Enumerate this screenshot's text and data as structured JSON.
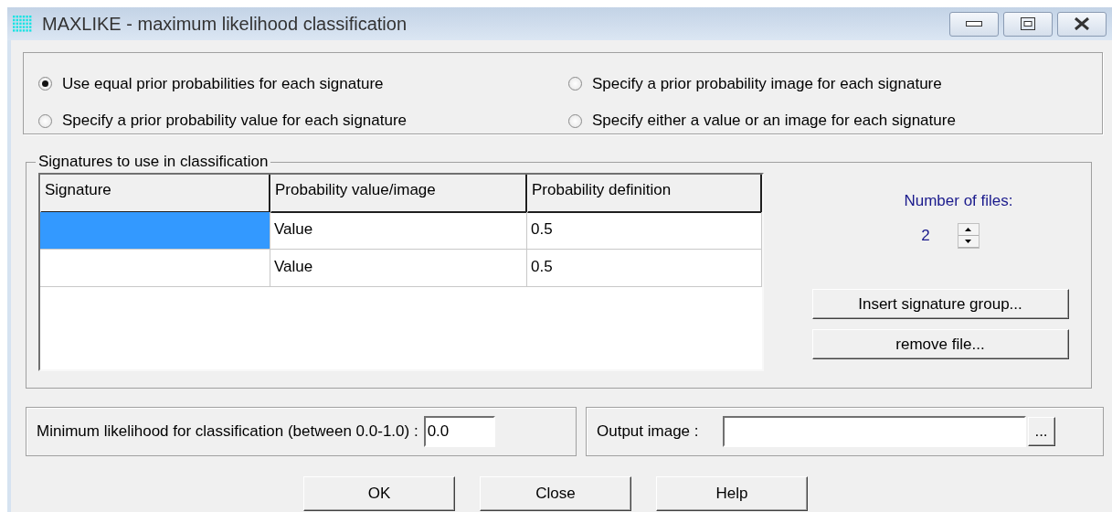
{
  "window": {
    "title": "MAXLIKE - maximum likelihood classification"
  },
  "prior_options": [
    {
      "label": "Use equal prior probabilities for each signature",
      "selected": true
    },
    {
      "label": "Specify a prior probability image for each signature",
      "selected": false
    },
    {
      "label": "Specify a prior probability value for each signature",
      "selected": false
    },
    {
      "label": "Specify either a value or an image for each signature",
      "selected": false
    }
  ],
  "signatures": {
    "title": "Signatures to use in classification",
    "table": {
      "columns": [
        "Signature",
        "Probability value/image",
        "Probability definition"
      ],
      "rows": [
        {
          "selected": true,
          "value_image": "Value",
          "definition": "0.5"
        },
        {
          "selected": false,
          "value_image": "Value",
          "definition": "0.5"
        }
      ]
    },
    "number_of_files": {
      "label": "Number of files:",
      "value": "2"
    },
    "buttons": [
      "Insert signature group...",
      "remove file..."
    ]
  },
  "min_likelihood": {
    "label": "Minimum likelihood for classification (between 0.0-1.0) :",
    "value": "0.0"
  },
  "output_image": {
    "label": "Output image :",
    "browse": "..."
  },
  "buttons": [
    "OK",
    "Close",
    "Help"
  ]
}
